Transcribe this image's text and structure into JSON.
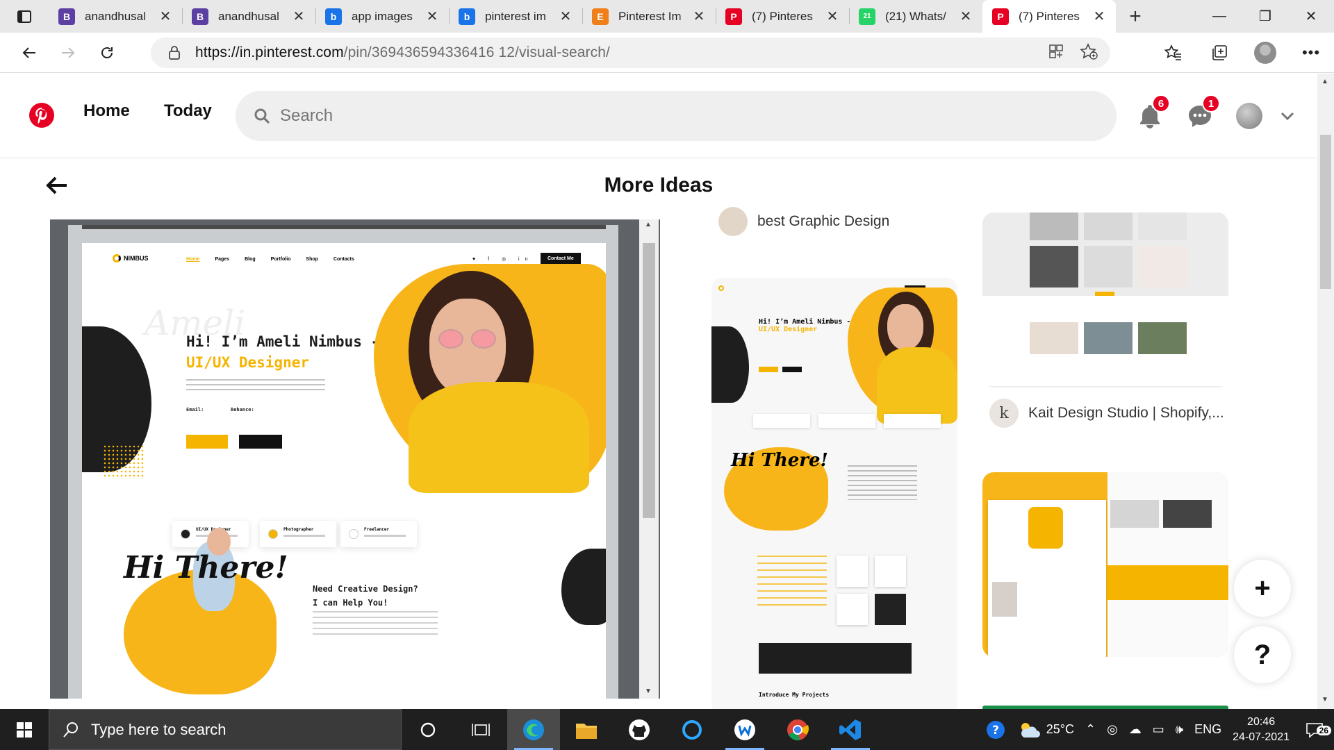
{
  "browser": {
    "tabs": [
      {
        "title": "anandhusal",
        "favicon": "B",
        "favicon_color": "#5c3fa3",
        "active": false
      },
      {
        "title": "anandhusal",
        "favicon": "B",
        "favicon_color": "#5c3fa3",
        "active": false
      },
      {
        "title": "app images",
        "favicon": "b",
        "favicon_color": "#1a73e8",
        "active": false
      },
      {
        "title": "pinterest im",
        "favicon": "b",
        "favicon_color": "#1a73e8",
        "active": false
      },
      {
        "title": "Pinterest Im",
        "favicon": "E",
        "favicon_color": "#ef7f1a",
        "active": false
      },
      {
        "title": "(7) Pinteres",
        "favicon": "P",
        "favicon_color": "#e60023",
        "active": false
      },
      {
        "title": "(21) Whats/",
        "favicon": "21",
        "favicon_color": "#25d366",
        "active": false
      },
      {
        "title": "(7) Pinteres",
        "favicon": "P",
        "favicon_color": "#e60023",
        "active": true
      }
    ],
    "tab_close": "✕",
    "new_tab": "+",
    "url_host": "https://in.pinterest.com",
    "url_path": "/pin/369436594336416 12/visual-search/",
    "window_controls": {
      "minimize": "—",
      "maximize": "❐",
      "close": "✕"
    }
  },
  "pinterest": {
    "brand_color": "#e60023",
    "nav": {
      "home": "Home",
      "today": "Today"
    },
    "search": {
      "placeholder": "Search"
    },
    "notifications_count": "6",
    "messages_count": "1",
    "section_title": "More Ideas"
  },
  "main_pin": {
    "site_logo": "NIMBUS",
    "nav_links": [
      "Home",
      "Pages",
      "Blog",
      "Portfolio",
      "Shop",
      "Contacts"
    ],
    "contact_button": "Contact Me",
    "headline_1": "Hi! I’m Ameli Nimbus -",
    "headline_2": "UI/UX Designer",
    "ghost_text": "Ameli",
    "email_label": "Email:",
    "behance_label": "Behance:",
    "services": [
      {
        "title": "UI/UX Designer",
        "dot": "#1e1e1e"
      },
      {
        "title": "Photographer",
        "dot": "#f5b400"
      },
      {
        "title": "Freelancer",
        "dot": "#ffffff"
      }
    ],
    "hi_there": "Hi There!",
    "need_heading_1": "Need Creative Design?",
    "need_heading_2": "I can Help You!"
  },
  "related_pins": [
    {
      "title": "best Graphic Design"
    },
    {
      "title": "Kait Design Studio | Shopify,...",
      "avatar_letter": "k"
    }
  ],
  "fab": {
    "add": "+",
    "help": "?"
  },
  "taskbar": {
    "search_placeholder": "Type here to search",
    "weather": "25°C",
    "language": "ENG",
    "time": "20:46",
    "date": "24-07-2021",
    "notifications": "26"
  }
}
